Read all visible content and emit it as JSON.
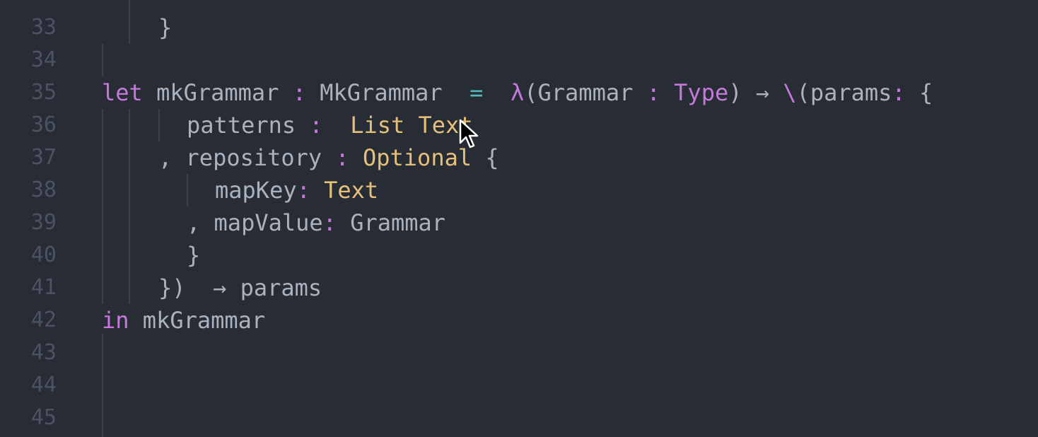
{
  "editor": {
    "colors": {
      "background": "#282c34",
      "line_number": "#4b5263",
      "keyword": "#c678dd",
      "operator": "#56b6c2",
      "type": "#e5c07b",
      "identifier": "#abb2bf"
    },
    "lines": [
      {
        "number": "33",
        "tokens": [
          "}"
        ]
      },
      {
        "number": "34",
        "tokens": []
      },
      {
        "number": "35",
        "tokens": [
          "let",
          " mkGrammar ",
          ":",
          " MkGrammar  ",
          "=",
          "  ",
          "λ",
          "(Grammar ",
          ":",
          " ",
          "Type",
          ") → ",
          "\\",
          "(params",
          ":",
          " {"
        ]
      },
      {
        "number": "36",
        "tokens": [
          "patterns ",
          ":",
          "  ",
          "List Text"
        ]
      },
      {
        "number": "37",
        "tokens": [
          ", repository ",
          ":",
          " ",
          "Optional",
          " {"
        ]
      },
      {
        "number": "38",
        "tokens": [
          "mapKey",
          ":",
          " ",
          "Text"
        ]
      },
      {
        "number": "39",
        "tokens": [
          ", mapValue",
          ":",
          " Grammar"
        ]
      },
      {
        "number": "40",
        "tokens": [
          "}"
        ]
      },
      {
        "number": "41",
        "tokens": [
          "})  → params"
        ]
      },
      {
        "number": "42",
        "tokens": [
          "in",
          " mkGrammar"
        ]
      },
      {
        "number": "43",
        "tokens": []
      },
      {
        "number": "44",
        "tokens": []
      },
      {
        "number": "45",
        "tokens": []
      }
    ]
  },
  "cursor": {
    "icon": "mouse-pointer-icon"
  }
}
